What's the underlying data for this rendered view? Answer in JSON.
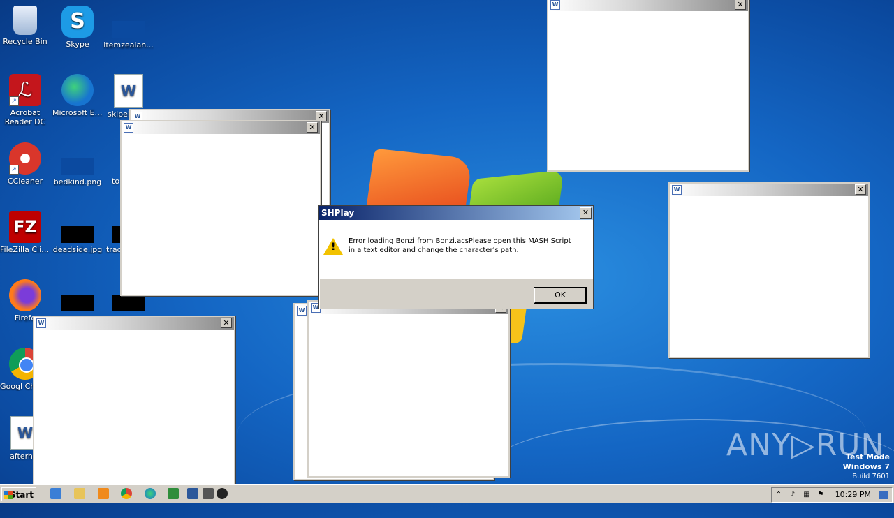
{
  "desktop": {
    "icons": [
      {
        "label": "Recycle Bin",
        "icon": "recycle-bin-icon"
      },
      {
        "label": "Skype",
        "icon": "skype-icon",
        "glyph": "S"
      },
      {
        "label": "itemzealan...",
        "icon": "file-icon"
      },
      {
        "label": "Acrobat Reader DC",
        "icon": "acrobat-icon"
      },
      {
        "label": "Microsoft Edge",
        "icon": "edge-icon"
      },
      {
        "label": "skipele",
        "icon": "word-doc-icon",
        "glyph": "W"
      },
      {
        "label": "CCleaner",
        "icon": "ccleaner-icon"
      },
      {
        "label": "bedkind.png",
        "icon": "image-file-icon"
      },
      {
        "label": "to",
        "icon": "word-doc-icon"
      },
      {
        "label": "FileZilla Client",
        "icon": "filezilla-icon",
        "glyph": "FZ"
      },
      {
        "label": "deadside.jpg",
        "icon": "image-file-icon"
      },
      {
        "label": "trac",
        "icon": "file-icon"
      },
      {
        "label": "Firefo",
        "icon": "firefox-icon"
      },
      {
        "label": "Googl Chrom",
        "icon": "chrome-icon"
      },
      {
        "label": "afterhot",
        "icon": "word-doc-icon",
        "glyph": "W"
      }
    ]
  },
  "dialog": {
    "title": "SHPlay",
    "close": "✕",
    "message": "Error loading Bonzi from Bonzi.acsPlease open this MASH Script in a text editor and change the character's path.",
    "ok_label": "OK"
  },
  "windows": {
    "close": "✕",
    "doc_glyph": "W"
  },
  "taskbar": {
    "start_label": "Start",
    "clock": "10:29 PM",
    "show_hidden": "⌃"
  },
  "watermark": "ANY▷RUN",
  "test_mode": {
    "line1": "Test Mode",
    "line2": "Windows 7",
    "line3": "Build 7601"
  },
  "colors": {
    "desktop_blue": "#1466c4",
    "dialog_title": "#0a246a",
    "warning": "#f2c200"
  }
}
